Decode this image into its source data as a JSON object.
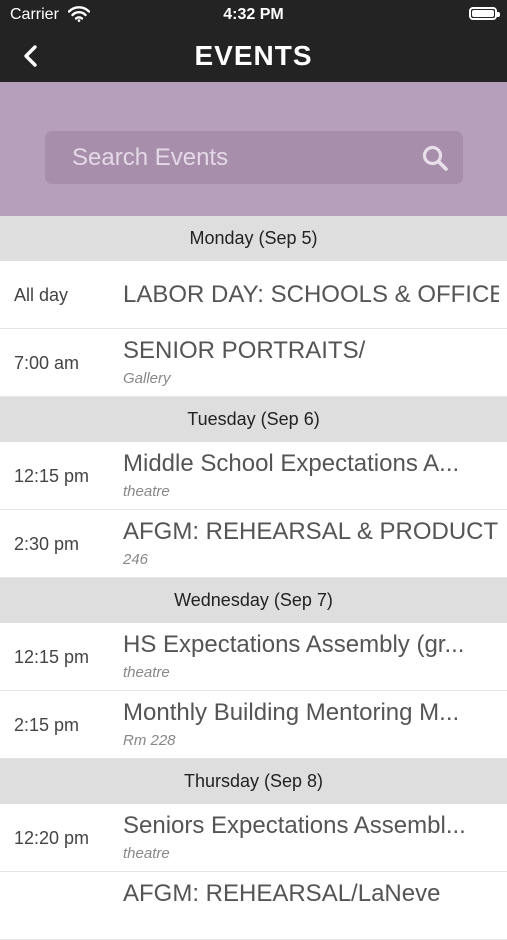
{
  "status_bar": {
    "carrier": "Carrier",
    "time": "4:32 PM"
  },
  "nav": {
    "title": "EVENTS"
  },
  "search": {
    "placeholder": "Search Events"
  },
  "colors": {
    "bar_bg": "#232323",
    "search_area_bg": "#b59fba",
    "day_header_bg": "#dedede"
  },
  "days": [
    {
      "label": "Monday (Sep 5)",
      "events": [
        {
          "time": "All day",
          "title": "LABOR DAY:  SCHOOLS & OFFICE",
          "location": ""
        },
        {
          "time": "7:00 am",
          "title": "SENIOR PORTRAITS/",
          "location": "Gallery"
        }
      ]
    },
    {
      "label": "Tuesday (Sep 6)",
      "events": [
        {
          "time": "12:15 pm",
          "title": "Middle School Expectations A...",
          "location": "theatre"
        },
        {
          "time": "2:30 pm",
          "title": "AFGM:  REHEARSAL & PRODUCTI",
          "location": "246"
        }
      ]
    },
    {
      "label": "Wednesday (Sep 7)",
      "events": [
        {
          "time": "12:15 pm",
          "title": "HS Expectations Assembly (gr...",
          "location": "theatre"
        },
        {
          "time": "2:15 pm",
          "title": "Monthly Building Mentoring M...",
          "location": "Rm 228"
        }
      ]
    },
    {
      "label": "Thursday (Sep 8)",
      "events": [
        {
          "time": "12:20 pm",
          "title": "Seniors Expectations Assembl...",
          "location": "theatre"
        },
        {
          "time": "",
          "title": "AFGM:  REHEARSAL/LaNeve",
          "location": ""
        }
      ]
    }
  ]
}
